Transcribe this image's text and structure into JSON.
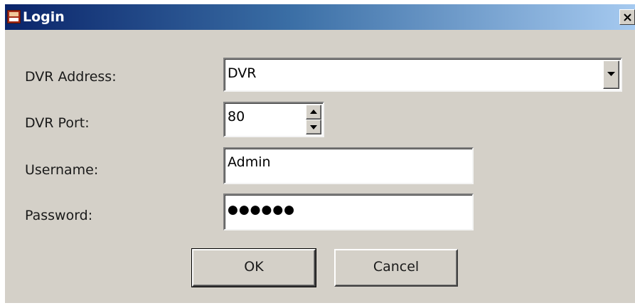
{
  "window": {
    "title": "Login",
    "app_icon": "dvr-app-icon",
    "close_icon": "close-icon"
  },
  "form": {
    "dvr_address": {
      "label": "DVR Address:",
      "value": "DVR",
      "dropdown_icon": "chevron-down-icon"
    },
    "dvr_port": {
      "label": "DVR Port:",
      "value": "80",
      "up_icon": "chevron-up-icon",
      "down_icon": "chevron-down-icon"
    },
    "username": {
      "label": "Username:",
      "value": "Admin"
    },
    "password": {
      "label": "Password:",
      "value": "●●●●●●"
    }
  },
  "buttons": {
    "ok_label": "OK",
    "cancel_label": "Cancel"
  },
  "colors": {
    "titlebar_start": "#0a246a",
    "titlebar_end": "#a6caf0",
    "dialog_face": "#d4d0c8"
  }
}
